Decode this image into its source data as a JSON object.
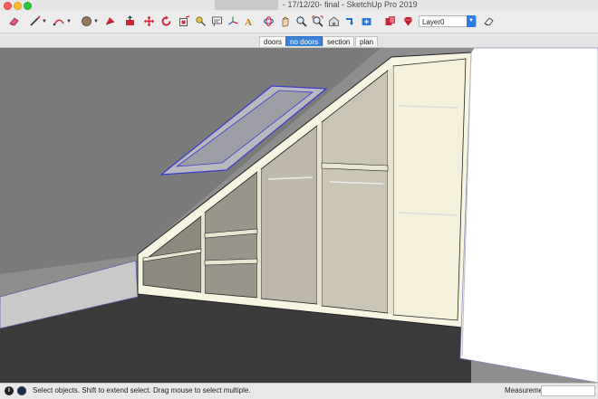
{
  "window": {
    "title": "- 17/12/20- final - SketchUp Pro 2019"
  },
  "toolbar": {
    "tools": [
      {
        "icon": "eraser-icon"
      },
      {
        "icon": "line-pencil-icon"
      },
      {
        "icon": "freehand-arc-icon"
      },
      {
        "icon": "paint-bucket-icon"
      },
      {
        "icon": "move-icon"
      },
      {
        "icon": "push-pull-icon"
      },
      {
        "icon": "rotate-icon"
      },
      {
        "icon": "scale-icon"
      },
      {
        "icon": "offset-icon"
      },
      {
        "icon": "tape-measure-icon"
      },
      {
        "icon": "text-icon"
      },
      {
        "icon": "axes-icon"
      },
      {
        "icon": "3d-text-icon"
      },
      {
        "icon": "orbit-icon"
      },
      {
        "icon": "pan-icon"
      },
      {
        "icon": "zoom-icon"
      },
      {
        "icon": "zoom-extents-icon"
      },
      {
        "icon": "warehouse-icon"
      },
      {
        "icon": "share-component-icon"
      },
      {
        "icon": "extension-warehouse-icon"
      },
      {
        "icon": "layout-icon"
      },
      {
        "icon": "ruby-icon"
      }
    ],
    "layer": "Layer0",
    "colors": {
      "accent": "#2c7be5",
      "red_tool": "#d0263a"
    }
  },
  "scenes": {
    "tabs": [
      {
        "label": "doors",
        "active": false
      },
      {
        "label": "no doors",
        "active": true
      },
      {
        "label": "section",
        "active": false
      },
      {
        "label": "plan",
        "active": false
      }
    ]
  },
  "status": {
    "text": "Select objects. Shift to extend select. Drag mouse to select multiple.",
    "measurements_label": "Measurements",
    "measurements_value": ""
  }
}
